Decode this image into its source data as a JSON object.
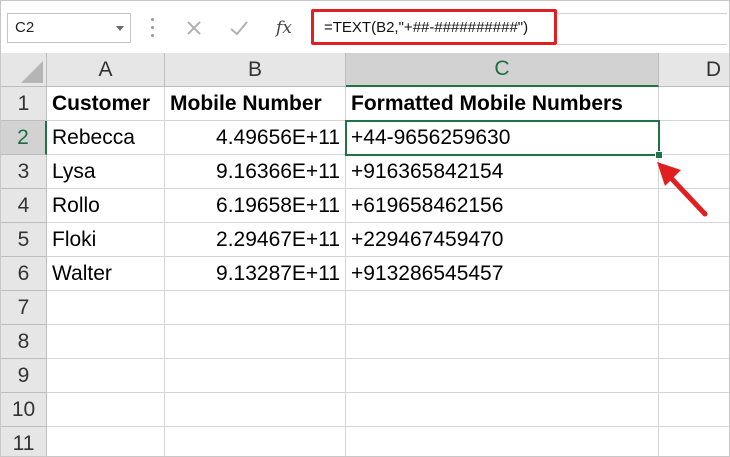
{
  "formula_bar": {
    "name_box": "C2",
    "formula": "=TEXT(B2,\"+##-##########\")",
    "cancel_icon": "close-icon",
    "enter_icon": "check-icon",
    "function_label": "fx"
  },
  "columns": [
    "A",
    "B",
    "C",
    "D"
  ],
  "rows": [
    "1",
    "2",
    "3",
    "4",
    "5",
    "6",
    "7",
    "8",
    "9",
    "10",
    "11"
  ],
  "table": {
    "headers": [
      "Customer",
      "Mobile Number",
      "Formatted Mobile Numbers"
    ],
    "data": [
      [
        "Rebecca",
        "4.49656E+11",
        "+44-9656259630"
      ],
      [
        "Lysa",
        "9.16366E+11",
        "+916365842154"
      ],
      [
        "Rollo",
        "6.19658E+11",
        "+619658462156"
      ],
      [
        "Floki",
        "2.29467E+11",
        "+229467459470"
      ],
      [
        "Walter",
        "9.13287E+11",
        "+913286545457"
      ]
    ]
  },
  "selection": {
    "active_cell": "C2"
  },
  "colors": {
    "selection": "#217346",
    "highlight": "#e02020"
  }
}
